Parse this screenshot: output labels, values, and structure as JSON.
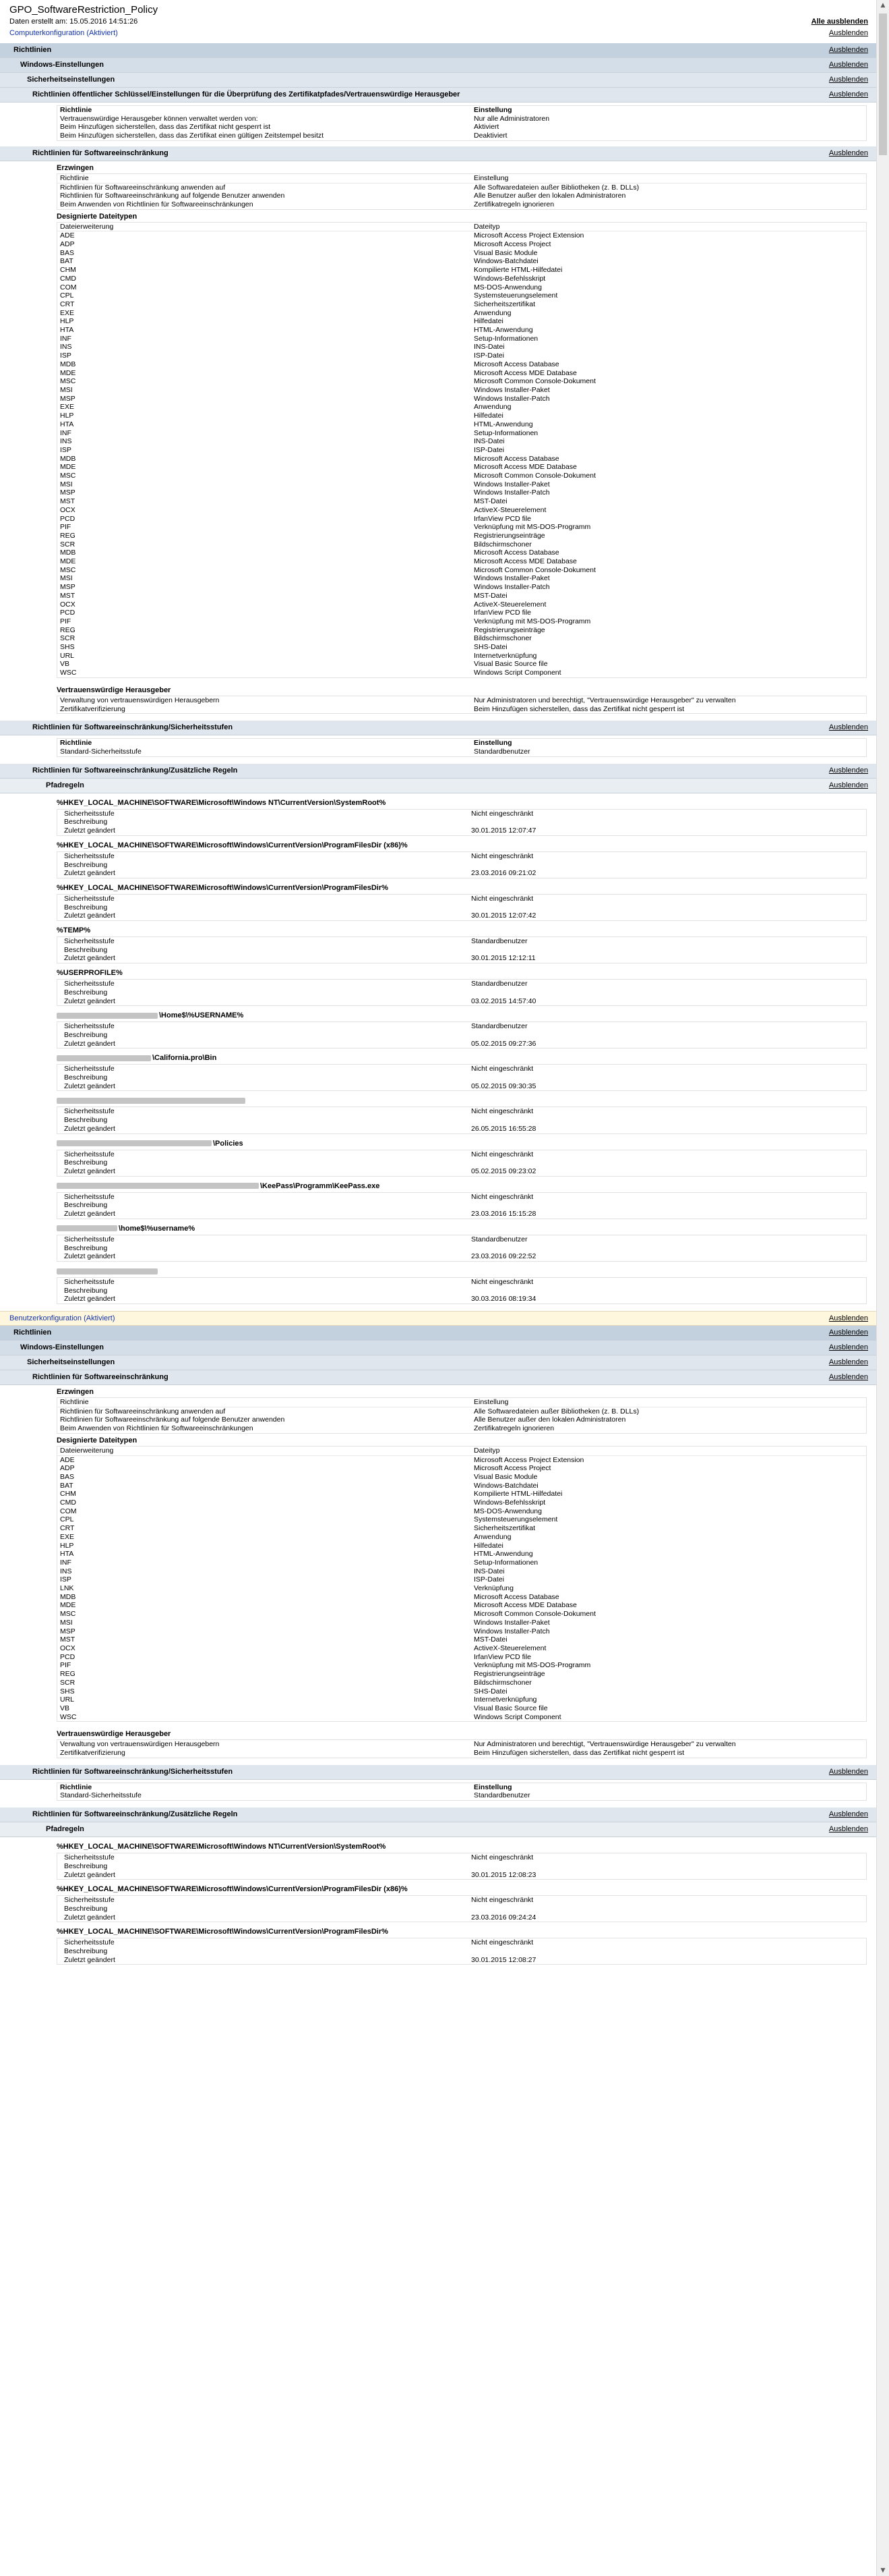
{
  "header": {
    "title": "GPO_SoftwareRestriction_Policy",
    "date_label": "Daten erstellt am: 15.05.2016 14:51:26",
    "hide_all": "Alle ausblenden",
    "hide": "Ausblenden"
  },
  "computer": {
    "section_title": "Computerkonfiguration (Aktiviert)",
    "bar_richtlinien": "Richtlinien",
    "bar_windows": "Windows-Einstellungen",
    "bar_sicherheit": "Sicherheitseinstellungen",
    "bar_pubkey": "Richtlinien öffentlicher Schlüssel/Einstellungen für die Überprüfung des Zertifikatpfades/Vertrauenswürdige Herausgeber",
    "pubkey_rows": [
      [
        "Richtlinie",
        "Einstellung"
      ],
      [
        "Vertrauenswürdige Herausgeber können verwaltet werden von:",
        "Nur alle Administratoren"
      ],
      [
        "Beim Hinzufügen sicherstellen, dass das Zertifikat nicht gesperrt ist",
        "Aktiviert"
      ],
      [
        "Beim Hinzufügen sicherstellen, dass das Zertifikat einen gültigen Zeitstempel besitzt",
        "Deaktiviert"
      ]
    ],
    "bar_srp": "Richtlinien für Softwareeinschränkung",
    "erzwingen_label": "Erzwingen",
    "erzwingen_rows": [
      [
        "Richtlinie",
        "Einstellung"
      ],
      [
        "Richtlinien für Softwareeinschränkung anwenden auf",
        "Alle Softwaredateien außer Bibliotheken (z. B. DLLs)"
      ],
      [
        "Richtlinien für Softwareeinschränkung auf folgende Benutzer anwenden",
        "Alle Benutzer außer den lokalen Administratoren"
      ],
      [
        "Beim Anwenden von Richtlinien für Softwareeinschränkungen",
        "Zertifikatregeln ignorieren"
      ]
    ],
    "dateitypen_label": "Designierte Dateitypen",
    "dateitypen_rows": [
      [
        "Dateierweiterung",
        "Dateityp"
      ],
      [
        "ADE",
        "Microsoft Access Project Extension"
      ],
      [
        "ADP",
        "Microsoft Access Project"
      ],
      [
        "BAS",
        "Visual Basic Module"
      ],
      [
        "BAT",
        "Windows-Batchdatei"
      ],
      [
        "CHM",
        "Kompilierte HTML-Hilfedatei"
      ],
      [
        "CMD",
        "Windows-Befehlsskript"
      ],
      [
        "COM",
        "MS-DOS-Anwendung"
      ],
      [
        "CPL",
        "Systemsteuerungselement"
      ],
      [
        "CRT",
        "Sicherheitszertifikat"
      ],
      [
        "EXE",
        "Anwendung"
      ],
      [
        "HLP",
        "Hilfedatei"
      ],
      [
        "HTA",
        "HTML-Anwendung"
      ],
      [
        "INF",
        "Setup-Informationen"
      ],
      [
        "INS",
        "INS-Datei"
      ],
      [
        "ISP",
        "ISP-Datei"
      ],
      [
        "MDB",
        "Microsoft Access Database"
      ],
      [
        "MDE",
        "Microsoft Access MDE Database"
      ],
      [
        "MSC",
        "Microsoft Common Console-Dokument"
      ],
      [
        "MSI",
        "Windows Installer-Paket"
      ],
      [
        "MSP",
        "Windows Installer-Patch"
      ],
      [
        "EXE",
        "Anwendung"
      ],
      [
        "HLP",
        "Hilfedatei"
      ],
      [
        "HTA",
        "HTML-Anwendung"
      ],
      [
        "INF",
        "Setup-Informationen"
      ],
      [
        "INS",
        "INS-Datei"
      ],
      [
        "ISP",
        "ISP-Datei"
      ],
      [
        "MDB",
        "Microsoft Access Database"
      ],
      [
        "MDE",
        "Microsoft Access MDE Database"
      ],
      [
        "MSC",
        "Microsoft Common Console-Dokument"
      ],
      [
        "MSI",
        "Windows Installer-Paket"
      ],
      [
        "MSP",
        "Windows Installer-Patch"
      ],
      [
        "MST",
        "MST-Datei"
      ],
      [
        "OCX",
        "ActiveX-Steuerelement"
      ],
      [
        "PCD",
        "IrfanView PCD file"
      ],
      [
        "PIF",
        "Verknüpfung mit MS-DOS-Programm"
      ],
      [
        "REG",
        "Registrierungseinträge"
      ],
      [
        "SCR",
        "Bildschirmschoner"
      ],
      [
        "MDB",
        "Microsoft Access Database"
      ],
      [
        "MDE",
        "Microsoft Access MDE Database"
      ],
      [
        "MSC",
        "Microsoft Common Console-Dokument"
      ],
      [
        "MSI",
        "Windows Installer-Paket"
      ],
      [
        "MSP",
        "Windows Installer-Patch"
      ],
      [
        "MST",
        "MST-Datei"
      ],
      [
        "OCX",
        "ActiveX-Steuerelement"
      ],
      [
        "PCD",
        "IrfanView PCD file"
      ],
      [
        "PIF",
        "Verknüpfung mit MS-DOS-Programm"
      ],
      [
        "REG",
        "Registrierungseinträge"
      ],
      [
        "SCR",
        "Bildschirmschoner"
      ],
      [
        "SHS",
        "SHS-Datei"
      ],
      [
        "URL",
        "Internetverknüpfung"
      ],
      [
        "VB",
        "Visual Basic Source file"
      ],
      [
        "WSC",
        "Windows Script Component"
      ]
    ],
    "herausgeber_label": "Vertrauenswürdige Herausgeber",
    "herausgeber_rows": [
      [
        "Verwaltung von vertrauenswürdigen Herausgebern",
        "Nur Administratoren und berechtigt, \"Vertrauenswürdige Herausgeber\" zu verwalten"
      ],
      [
        "Zertifikatverifizierung",
        "Beim Hinzufügen sicherstellen, dass das Zertifikat nicht gesperrt ist"
      ]
    ],
    "bar_stufen": "Richtlinien für Softwareeinschränkung/Sicherheitsstufen",
    "stufen_rows": [
      [
        "Richtlinie",
        "Einstellung"
      ],
      [
        "Standard-Sicherheitsstufe",
        "Standardbenutzer"
      ]
    ],
    "bar_regeln": "Richtlinien für Softwareeinschränkung/Zusätzliche Regeln",
    "pfadregeln_label": "Pfadregeln",
    "rules": [
      {
        "path": "%HKEY_LOCAL_MACHINE\\SOFTWARE\\Microsoft\\Windows NT\\CurrentVersion\\SystemRoot%",
        "stufe": "Nicht eingeschränkt",
        "desc": "",
        "date": "30.01.2015 12:07:47"
      },
      {
        "path": "%HKEY_LOCAL_MACHINE\\SOFTWARE\\Microsoft\\Windows\\CurrentVersion\\ProgramFilesDir (x86)%",
        "stufe": "Nicht eingeschränkt",
        "desc": "",
        "date": "23.03.2016 09:21:02"
      },
      {
        "path": "%HKEY_LOCAL_MACHINE\\SOFTWARE\\Microsoft\\Windows\\CurrentVersion\\ProgramFilesDir%",
        "stufe": "Nicht eingeschränkt",
        "desc": "",
        "date": "30.01.2015 12:07:42"
      },
      {
        "path": "%TEMP%",
        "stufe": "Standardbenutzer",
        "desc": "",
        "date": "30.01.2015 12:12:11"
      },
      {
        "path": "%USERPROFILE%",
        "stufe": "Standardbenutzer",
        "desc": "",
        "date": "03.02.2015 14:57:40"
      },
      {
        "path": "\\Home$\\%USERNAME%",
        "redact": 150,
        "stufe": "Standardbenutzer",
        "desc": "",
        "date": "05.02.2015 09:27:36"
      },
      {
        "path": "\\California.pro\\Bin",
        "redact": 140,
        "stufe": "Nicht eingeschränkt",
        "desc": "",
        "date": "05.02.2015 09:30:35"
      },
      {
        "path": "",
        "redact": 280,
        "stufe": "Nicht eingeschränkt",
        "desc": "",
        "date": "26.05.2015 16:55:28"
      },
      {
        "path": "\\Policies",
        "redact": 230,
        "stufe": "Nicht eingeschränkt",
        "desc": "",
        "date": "05.02.2015 09:23:02"
      },
      {
        "path": "\\KeePass\\Programm\\KeePass.exe",
        "redact": 300,
        "stufe": "Nicht eingeschränkt",
        "desc": "",
        "date": "23.03.2016 15:15:28"
      },
      {
        "path": "\\home$\\%username%",
        "redact": 90,
        "stufe": "Standardbenutzer",
        "desc": "",
        "date": "23.03.2016 09:22:52"
      },
      {
        "path": "",
        "redact": 150,
        "stufe": "Nicht eingeschränkt",
        "desc": "",
        "date": "30.03.2016 08:19:34"
      }
    ],
    "rule_labels": {
      "stufe": "Sicherheitsstufe",
      "desc": "Beschreibung",
      "date": "Zuletzt geändert"
    }
  },
  "user": {
    "section_title": "Benutzerkonfiguration (Aktiviert)",
    "bar_richtlinien": "Richtlinien",
    "bar_windows": "Windows-Einstellungen",
    "bar_sicherheit": "Sicherheitseinstellungen",
    "bar_srp": "Richtlinien für Softwareeinschränkung",
    "erzwingen_label": "Erzwingen",
    "erzwingen_rows": [
      [
        "Richtlinie",
        "Einstellung"
      ],
      [
        "Richtlinien für Softwareeinschränkung anwenden auf",
        "Alle Softwaredateien außer Bibliotheken (z. B. DLLs)"
      ],
      [
        "Richtlinien für Softwareeinschränkung auf folgende Benutzer anwenden",
        "Alle Benutzer außer den lokalen Administratoren"
      ],
      [
        "Beim Anwenden von Richtlinien für Softwareeinschränkungen",
        "Zertifikatregeln ignorieren"
      ]
    ],
    "dateitypen_label": "Designierte Dateitypen",
    "dateitypen_rows": [
      [
        "Dateierweiterung",
        "Dateityp"
      ],
      [
        "ADE",
        "Microsoft Access Project Extension"
      ],
      [
        "ADP",
        "Microsoft Access Project"
      ],
      [
        "BAS",
        "Visual Basic Module"
      ],
      [
        "BAT",
        "Windows-Batchdatei"
      ],
      [
        "CHM",
        "Kompilierte HTML-Hilfedatei"
      ],
      [
        "CMD",
        "Windows-Befehlsskript"
      ],
      [
        "COM",
        "MS-DOS-Anwendung"
      ],
      [
        "CPL",
        "Systemsteuerungselement"
      ],
      [
        "CRT",
        "Sicherheitszertifikat"
      ],
      [
        "EXE",
        "Anwendung"
      ],
      [
        "HLP",
        "Hilfedatei"
      ],
      [
        "HTA",
        "HTML-Anwendung"
      ],
      [
        "INF",
        "Setup-Informationen"
      ],
      [
        "INS",
        "INS-Datei"
      ],
      [
        "ISP",
        "ISP-Datei"
      ],
      [
        "LNK",
        "Verknüpfung"
      ],
      [
        "MDB",
        "Microsoft Access Database"
      ],
      [
        "MDE",
        "Microsoft Access MDE Database"
      ],
      [
        "MSC",
        "Microsoft Common Console-Dokument"
      ],
      [
        "MSI",
        "Windows Installer-Paket"
      ],
      [
        "MSP",
        "Windows Installer-Patch"
      ],
      [
        "MST",
        "MST-Datei"
      ],
      [
        "OCX",
        "ActiveX-Steuerelement"
      ],
      [
        "PCD",
        "IrfanView PCD file"
      ],
      [
        "PIF",
        "Verknüpfung mit MS-DOS-Programm"
      ],
      [
        "REG",
        "Registrierungseinträge"
      ],
      [
        "SCR",
        "Bildschirmschoner"
      ],
      [
        "SHS",
        "SHS-Datei"
      ],
      [
        "URL",
        "Internetverknüpfung"
      ],
      [
        "VB",
        "Visual Basic Source file"
      ],
      [
        "WSC",
        "Windows Script Component"
      ]
    ],
    "herausgeber_label": "Vertrauenswürdige Herausgeber",
    "herausgeber_rows": [
      [
        "Verwaltung von vertrauenswürdigen Herausgebern",
        "Nur Administratoren und berechtigt, \"Vertrauenswürdige Herausgeber\" zu verwalten"
      ],
      [
        "Zertifikatverifizierung",
        "Beim Hinzufügen sicherstellen, dass das Zertifikat nicht gesperrt ist"
      ]
    ],
    "bar_stufen": "Richtlinien für Softwareeinschränkung/Sicherheitsstufen",
    "stufen_rows": [
      [
        "Richtlinie",
        "Einstellung"
      ],
      [
        "Standard-Sicherheitsstufe",
        "Standardbenutzer"
      ]
    ],
    "bar_regeln": "Richtlinien für Softwareeinschränkung/Zusätzliche Regeln",
    "pfadregeln_label": "Pfadregeln",
    "rules": [
      {
        "path": "%HKEY_LOCAL_MACHINE\\SOFTWARE\\Microsoft\\Windows NT\\CurrentVersion\\SystemRoot%",
        "stufe": "Nicht eingeschränkt",
        "desc": "",
        "date": "30.01.2015 12:08:23"
      },
      {
        "path": "%HKEY_LOCAL_MACHINE\\SOFTWARE\\Microsoft\\Windows\\CurrentVersion\\ProgramFilesDir (x86)%",
        "stufe": "Nicht eingeschränkt",
        "desc": "",
        "date": "23.03.2016 09:24:24"
      },
      {
        "path": "%HKEY_LOCAL_MACHINE\\SOFTWARE\\Microsoft\\Windows\\CurrentVersion\\ProgramFilesDir%",
        "stufe": "Nicht eingeschränkt",
        "desc": "",
        "date": "30.01.2015 12:08:27"
      }
    ],
    "rule_labels": {
      "stufe": "Sicherheitsstufe",
      "desc": "Beschreibung",
      "date": "Zuletzt geändert"
    }
  }
}
